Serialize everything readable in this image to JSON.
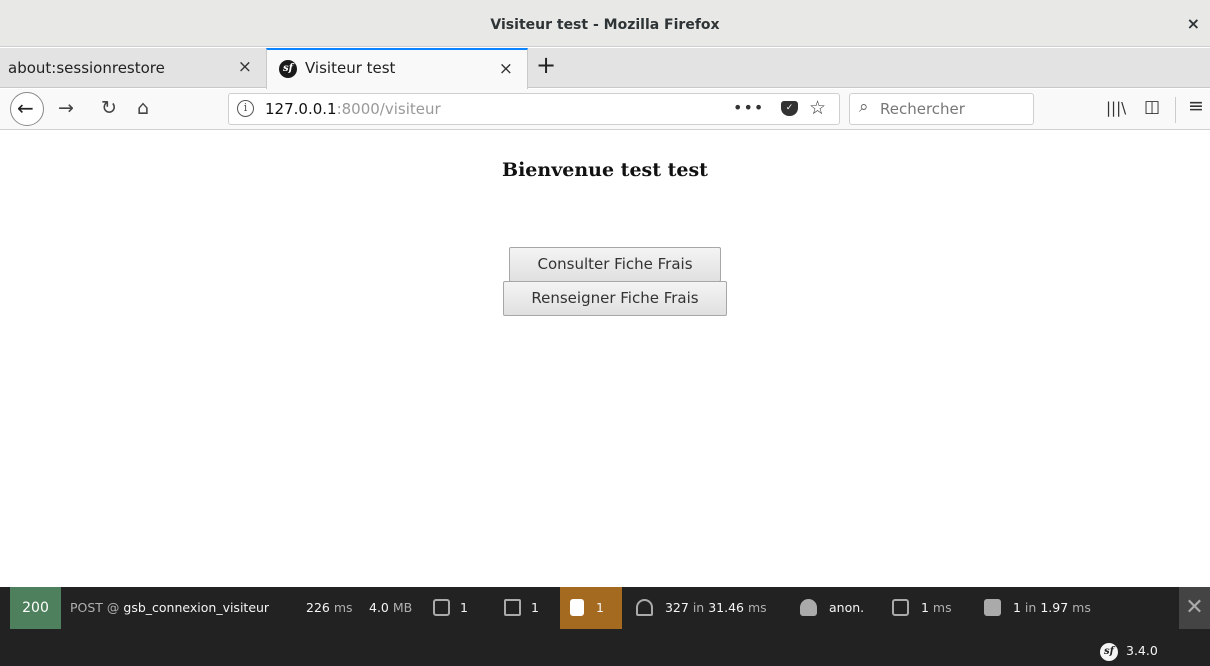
{
  "window": {
    "title": "Visiteur test - Mozilla Firefox",
    "close_glyph": "×"
  },
  "tabs": [
    {
      "label": "about:sessionrestore",
      "close_glyph": "×"
    },
    {
      "label": "Visiteur test",
      "close_glyph": "×",
      "favicon_text": "sf"
    }
  ],
  "newtab_glyph": "+",
  "nav": {
    "back_glyph": "←",
    "forward_glyph": "→",
    "reload_glyph": "↻",
    "home_glyph": "⌂",
    "url_host": "127.0.0.1",
    "url_rest": ":8000/visiteur",
    "info_glyph": "i",
    "more_glyph": "•••",
    "star_glyph": "☆",
    "search_placeholder": "Rechercher",
    "search_glyph": "⌕",
    "library_glyph": "|||\\",
    "sidebar_glyph": "◫",
    "menu_glyph": "≡"
  },
  "page": {
    "heading": "Bienvenue test test",
    "buttons": {
      "consult": "Consulter Fiche Frais",
      "renseigner": "Renseigner Fiche Frais"
    }
  },
  "symfony_toolbar": {
    "status": "200",
    "method": "POST @",
    "route": "gsb_connexion_visiteur",
    "time_value": "226",
    "time_unit": "ms",
    "memory_value": "4.0",
    "memory_unit": "MB",
    "forms_count": "1",
    "logs_count": "1",
    "warnings_count": "1",
    "cache_count": "327",
    "cache_in": "in",
    "cache_time": "31.46",
    "cache_unit": "ms",
    "user": "anon.",
    "twig_time": "1",
    "twig_unit": "ms",
    "db_count": "1",
    "db_in": "in",
    "db_time": "1.97",
    "db_unit": "ms",
    "close_glyph": "✕",
    "logo_text": "sf",
    "version": "3.4.0",
    "colors": {
      "status_ok": "#4f805d",
      "warning": "#a46a1f",
      "background": "#222222"
    }
  },
  "colors": {
    "active_tab_accent": "#0a84ff"
  }
}
